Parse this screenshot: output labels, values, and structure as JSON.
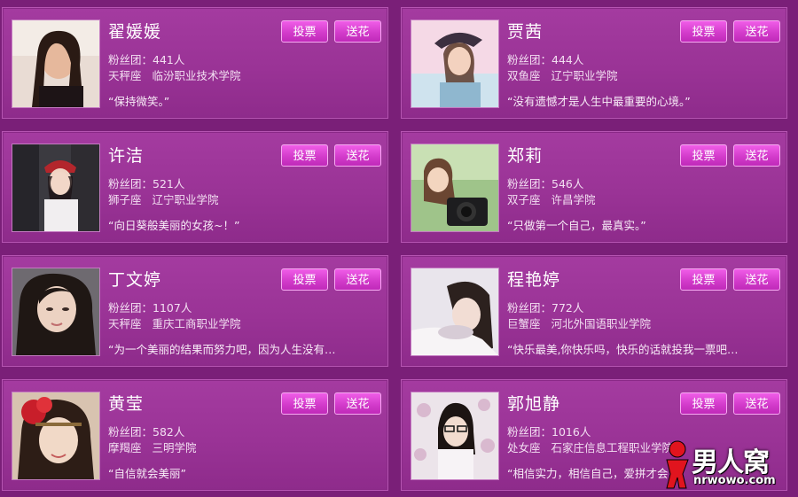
{
  "cards": [
    {
      "name": "翟媛媛",
      "fans_label": "粉丝团：",
      "fans": "441人",
      "sign": "天秤座",
      "school": "临汾职业技术学院",
      "quote": "“保持微笑。”",
      "vote_label": "投票",
      "flower_label": "送花"
    },
    {
      "name": "贾茜",
      "fans_label": "粉丝团：",
      "fans": "444人",
      "sign": "双鱼座",
      "school": "辽宁职业学院",
      "quote": "“没有遗憾才是人生中最重要的心境。”",
      "vote_label": "投票",
      "flower_label": "送花"
    },
    {
      "name": "许洁",
      "fans_label": "粉丝团：",
      "fans": "521人",
      "sign": "狮子座",
      "school": "辽宁职业学院",
      "quote": "“向日葵般美丽的女孩~！”",
      "vote_label": "投票",
      "flower_label": "送花"
    },
    {
      "name": "郑莉",
      "fans_label": "粉丝团：",
      "fans": "546人",
      "sign": "双子座",
      "school": "许昌学院",
      "quote": "“只做第一个自己，最真实。”",
      "vote_label": "投票",
      "flower_label": "送花"
    },
    {
      "name": "丁文婷",
      "fans_label": "粉丝团：",
      "fans": "1107人",
      "sign": "天秤座",
      "school": "重庆工商职业学院",
      "quote": "“为一个美丽的结果而努力吧，因为人生没有…",
      "vote_label": "投票",
      "flower_label": "送花"
    },
    {
      "name": "程艳婷",
      "fans_label": "粉丝团：",
      "fans": "772人",
      "sign": "巨蟹座",
      "school": "河北外国语职业学院",
      "quote": "“快乐最美,你快乐吗，快乐的话就投我一票吧…",
      "vote_label": "投票",
      "flower_label": "送花"
    },
    {
      "name": "黄莹",
      "fans_label": "粉丝团：",
      "fans": "582人",
      "sign": "摩羯座",
      "school": "三明学院",
      "quote": "“自信就会美丽”",
      "vote_label": "投票",
      "flower_label": "送花"
    },
    {
      "name": "郭旭静",
      "fans_label": "粉丝团：",
      "fans": "1016人",
      "sign": "处女座",
      "school": "石家庄信息工程职业学院",
      "quote": "“相信实力，相信自己，爱拼才会…",
      "vote_label": "投票",
      "flower_label": "送花"
    }
  ],
  "watermark": {
    "text": "男人窝",
    "url": "nrwowo.com"
  },
  "colors": {
    "background": "#7a1f78",
    "card": "#9a3396",
    "button": "#d33ccb"
  }
}
